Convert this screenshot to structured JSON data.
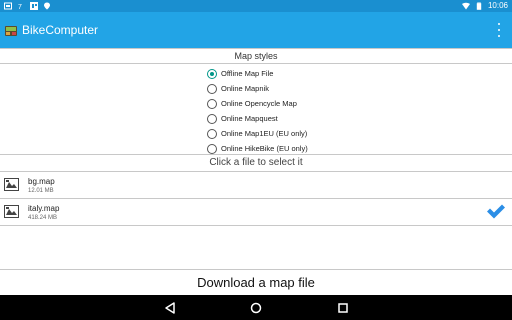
{
  "statusbar": {
    "time": "10:06",
    "left_icons": [
      "screenshot-icon",
      "notification-7-icon",
      "gallery-icon",
      "location-icon"
    ],
    "right_icons": [
      "wifi-icon",
      "battery-icon"
    ]
  },
  "appbar": {
    "title": "BikeComputer",
    "logo": "bike-computer-logo",
    "menu_icon": "overflow-menu-icon"
  },
  "map_styles": {
    "header": "Map styles",
    "options": [
      {
        "label": "Offline Map File",
        "checked": true
      },
      {
        "label": "Online Mapnik",
        "checked": false
      },
      {
        "label": "Online Opencycle Map",
        "checked": false
      },
      {
        "label": "Online Mapquest",
        "checked": false
      },
      {
        "label": "Online Map1EU (EU only)",
        "checked": false
      },
      {
        "label": "Online HikeBike (EU only)",
        "checked": false
      }
    ]
  },
  "files": {
    "header": "Click a file to select it",
    "items": [
      {
        "name": "bg.map",
        "size": "12.01 MB",
        "selected": false
      },
      {
        "name": "italy.map",
        "size": "418.24 MB",
        "selected": true
      }
    ]
  },
  "download": {
    "label": "Download a map file"
  },
  "navbar": {
    "buttons": [
      "back-icon",
      "home-icon",
      "recents-icon"
    ]
  },
  "colors": {
    "statusbar": "#1a8fd0",
    "appbar": "#22a4e6",
    "radio_accent": "#009688",
    "check": "#2b8ee6"
  }
}
